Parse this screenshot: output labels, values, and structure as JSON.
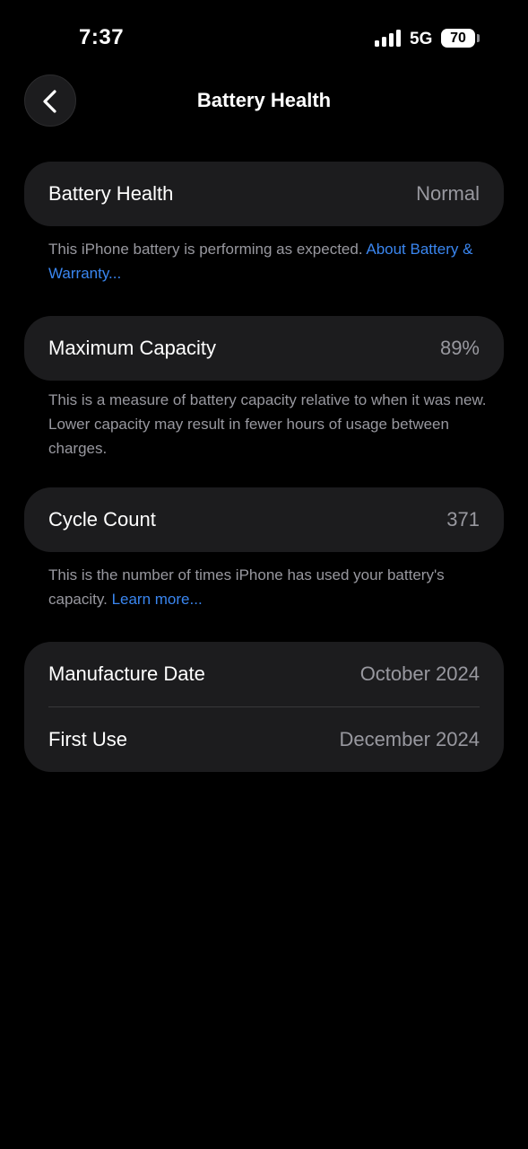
{
  "status_bar": {
    "time": "7:37",
    "network": "5G",
    "battery_level": "70",
    "signal_bars": 4
  },
  "nav": {
    "title": "Battery Health",
    "back_icon": "chevron-left-icon"
  },
  "battery_health": {
    "label": "Battery Health",
    "value": "Normal",
    "footnote_text": "This iPhone battery is performing as expected. ",
    "footnote_link": "About Battery & Warranty..."
  },
  "maximum_capacity": {
    "label": "Maximum Capacity",
    "value": "89%",
    "footnote_text": "This is a measure of battery capacity relative to when it was new. Lower capacity may result in fewer hours of usage between charges."
  },
  "cycle_count": {
    "label": "Cycle Count",
    "value": "371",
    "footnote_text": "This is the number of times iPhone has used your battery's capacity. ",
    "footnote_link": "Learn more..."
  },
  "dates": {
    "manufacture_label": "Manufacture Date",
    "manufacture_value": "October 2024",
    "first_use_label": "First Use",
    "first_use_value": "December 2024"
  },
  "colors": {
    "background": "#000000",
    "card": "#1c1c1e",
    "secondary_text": "#98989f",
    "link": "#3a86f0"
  }
}
